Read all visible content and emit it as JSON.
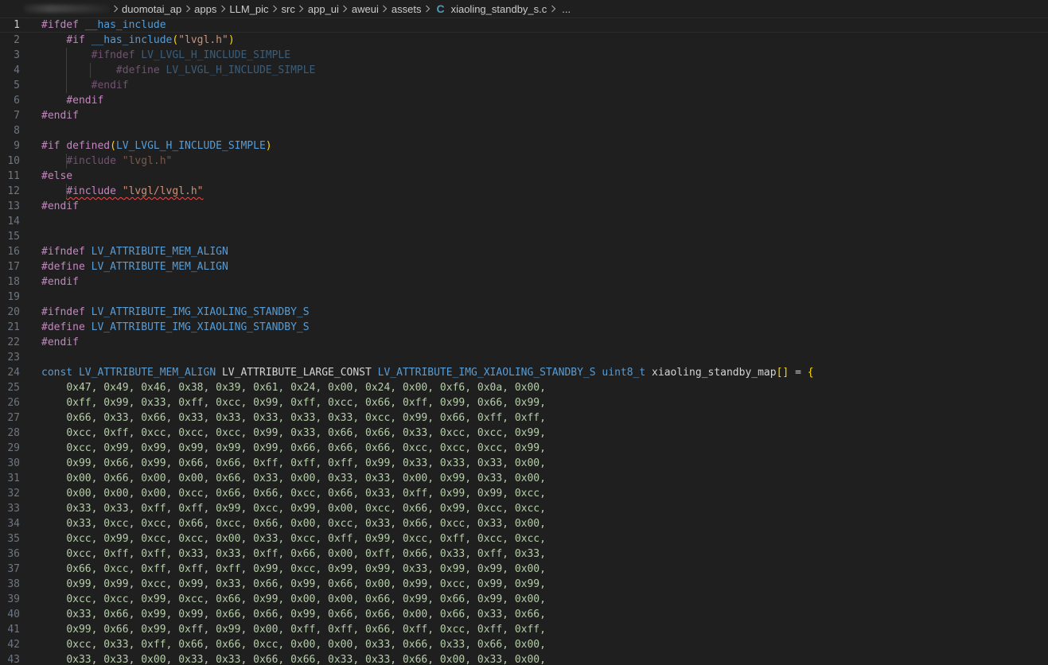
{
  "breadcrumb": {
    "segments": [
      "duomotai_ap",
      "apps",
      "LLM_pic",
      "src",
      "app_ui",
      "aweui",
      "assets"
    ],
    "file_icon": "C",
    "file_name": "xiaoling_standby_s.c",
    "trailing": "..."
  },
  "editor": {
    "current_line": 1,
    "colors": {
      "background": "#1f1f1f",
      "preprocessor": "#c586c0",
      "macro": "#569cd6",
      "string": "#ce9178",
      "number": "#b5cea8",
      "text": "#d4d4d4",
      "bracket": "#ffd700",
      "error_squiggle": "#f14c4c"
    },
    "lines": [
      {
        "n": "1",
        "guides": 0,
        "tokens": [
          {
            "t": "#ifdef ",
            "c": "t-kw"
          },
          {
            "t": "__has_include",
            "c": "t-macro"
          }
        ]
      },
      {
        "n": "2",
        "guides": 0,
        "indent": 1,
        "tokens": [
          {
            "t": "#if ",
            "c": "t-kw"
          },
          {
            "t": "__has_include",
            "c": "t-macro"
          },
          {
            "t": "(",
            "c": "t-br"
          },
          {
            "t": "\"lvgl.h\"",
            "c": "t-str"
          },
          {
            "t": ")",
            "c": "t-br"
          }
        ]
      },
      {
        "n": "3",
        "guides": 1,
        "indent": 2,
        "dim": true,
        "tokens": [
          {
            "t": "#ifndef ",
            "c": "t-kw"
          },
          {
            "t": "LV_LVGL_H_INCLUDE_SIMPLE",
            "c": "t-macro"
          }
        ]
      },
      {
        "n": "4",
        "guides": 2,
        "indent": 3,
        "dim": true,
        "tokens": [
          {
            "t": "#define ",
            "c": "t-kw"
          },
          {
            "t": "LV_LVGL_H_INCLUDE_SIMPLE",
            "c": "t-macro"
          }
        ]
      },
      {
        "n": "5",
        "guides": 1,
        "indent": 2,
        "dim": true,
        "tokens": [
          {
            "t": "#endif",
            "c": "t-kw"
          }
        ]
      },
      {
        "n": "6",
        "guides": 0,
        "indent": 1,
        "tokens": [
          {
            "t": "#endif",
            "c": "t-kw"
          }
        ]
      },
      {
        "n": "7",
        "guides": 0,
        "tokens": [
          {
            "t": "#endif",
            "c": "t-kw"
          }
        ]
      },
      {
        "n": "8",
        "guides": 0,
        "tokens": []
      },
      {
        "n": "9",
        "guides": 0,
        "tokens": [
          {
            "t": "#if ",
            "c": "t-kw"
          },
          {
            "t": "defined",
            "c": "t-kw"
          },
          {
            "t": "(",
            "c": "t-br"
          },
          {
            "t": "LV_LVGL_H_INCLUDE_SIMPLE",
            "c": "t-macro"
          },
          {
            "t": ")",
            "c": "t-br"
          }
        ]
      },
      {
        "n": "10",
        "guides": 0,
        "indent": 1,
        "dim": true,
        "guideAt1": true,
        "tokens": [
          {
            "t": "#include ",
            "c": "t-kw"
          },
          {
            "t": "\"lvgl.h\"",
            "c": "t-str"
          }
        ]
      },
      {
        "n": "11",
        "guides": 0,
        "tokens": [
          {
            "t": "#else",
            "c": "t-kw"
          }
        ]
      },
      {
        "n": "12",
        "guides": 0,
        "indent": 1,
        "guideAt1": true,
        "tokens": [
          {
            "t": "#include ",
            "c": "t-kw squiggle"
          },
          {
            "t": "\"lvgl/lvgl.h\"",
            "c": "t-str squiggle"
          }
        ]
      },
      {
        "n": "13",
        "guides": 0,
        "tokens": [
          {
            "t": "#endif",
            "c": "t-kw"
          }
        ]
      },
      {
        "n": "14",
        "guides": 0,
        "tokens": []
      },
      {
        "n": "15",
        "guides": 0,
        "tokens": []
      },
      {
        "n": "16",
        "guides": 0,
        "tokens": [
          {
            "t": "#ifndef ",
            "c": "t-kw"
          },
          {
            "t": "LV_ATTRIBUTE_MEM_ALIGN",
            "c": "t-macro"
          }
        ]
      },
      {
        "n": "17",
        "guides": 0,
        "tokens": [
          {
            "t": "#define ",
            "c": "t-kw"
          },
          {
            "t": "LV_ATTRIBUTE_MEM_ALIGN",
            "c": "t-macro"
          }
        ]
      },
      {
        "n": "18",
        "guides": 0,
        "tokens": [
          {
            "t": "#endif",
            "c": "t-kw"
          }
        ]
      },
      {
        "n": "19",
        "guides": 0,
        "tokens": []
      },
      {
        "n": "20",
        "guides": 0,
        "tokens": [
          {
            "t": "#ifndef ",
            "c": "t-kw"
          },
          {
            "t": "LV_ATTRIBUTE_IMG_XIAOLING_STANDBY_S",
            "c": "t-macro"
          }
        ]
      },
      {
        "n": "21",
        "guides": 0,
        "tokens": [
          {
            "t": "#define ",
            "c": "t-kw"
          },
          {
            "t": "LV_ATTRIBUTE_IMG_XIAOLING_STANDBY_S",
            "c": "t-macro"
          }
        ]
      },
      {
        "n": "22",
        "guides": 0,
        "tokens": [
          {
            "t": "#endif",
            "c": "t-kw"
          }
        ]
      },
      {
        "n": "23",
        "guides": 0,
        "tokens": []
      },
      {
        "n": "24",
        "guides": 0,
        "tokens": [
          {
            "t": "const ",
            "c": "t-macro"
          },
          {
            "t": "LV_ATTRIBUTE_MEM_ALIGN ",
            "c": "t-macro"
          },
          {
            "t": "LV_ATTRIBUTE_LARGE_CONST ",
            "c": "t-text"
          },
          {
            "t": "LV_ATTRIBUTE_IMG_XIAOLING_STANDBY_S ",
            "c": "t-macro"
          },
          {
            "t": "uint8_t ",
            "c": "t-macro"
          },
          {
            "t": "xiaoling_standby_map",
            "c": "t-text"
          },
          {
            "t": "[]",
            "c": "t-br"
          },
          {
            "t": " = ",
            "c": "t-text"
          },
          {
            "t": "{",
            "c": "t-br"
          }
        ]
      },
      {
        "n": "25",
        "indent": 1,
        "hex": "0x47, 0x49, 0x46, 0x38, 0x39, 0x61, 0x24, 0x00, 0x24, 0x00, 0xf6, 0x0a, 0x00,"
      },
      {
        "n": "26",
        "indent": 1,
        "hex": "0xff, 0x99, 0x33, 0xff, 0xcc, 0x99, 0xff, 0xcc, 0x66, 0xff, 0x99, 0x66, 0x99,"
      },
      {
        "n": "27",
        "indent": 1,
        "hex": "0x66, 0x33, 0x66, 0x33, 0x33, 0x33, 0x33, 0x33, 0xcc, 0x99, 0x66, 0xff, 0xff,"
      },
      {
        "n": "28",
        "indent": 1,
        "hex": "0xcc, 0xff, 0xcc, 0xcc, 0xcc, 0x99, 0x33, 0x66, 0x66, 0x33, 0xcc, 0xcc, 0x99,"
      },
      {
        "n": "29",
        "indent": 1,
        "hex": "0xcc, 0x99, 0x99, 0x99, 0x99, 0x99, 0x66, 0x66, 0x66, 0xcc, 0xcc, 0xcc, 0x99,"
      },
      {
        "n": "30",
        "indent": 1,
        "hex": "0x99, 0x66, 0x99, 0x66, 0x66, 0xff, 0xff, 0xff, 0x99, 0x33, 0x33, 0x33, 0x00,"
      },
      {
        "n": "31",
        "indent": 1,
        "hex": "0x00, 0x66, 0x00, 0x00, 0x66, 0x33, 0x00, 0x33, 0x33, 0x00, 0x99, 0x33, 0x00,"
      },
      {
        "n": "32",
        "indent": 1,
        "hex": "0x00, 0x00, 0x00, 0xcc, 0x66, 0x66, 0xcc, 0x66, 0x33, 0xff, 0x99, 0x99, 0xcc,"
      },
      {
        "n": "33",
        "indent": 1,
        "hex": "0x33, 0x33, 0xff, 0xff, 0x99, 0xcc, 0x99, 0x00, 0xcc, 0x66, 0x99, 0xcc, 0xcc,"
      },
      {
        "n": "34",
        "indent": 1,
        "hex": "0x33, 0xcc, 0xcc, 0x66, 0xcc, 0x66, 0x00, 0xcc, 0x33, 0x66, 0xcc, 0x33, 0x00,"
      },
      {
        "n": "35",
        "indent": 1,
        "hex": "0xcc, 0x99, 0xcc, 0xcc, 0x00, 0x33, 0xcc, 0xff, 0x99, 0xcc, 0xff, 0xcc, 0xcc,"
      },
      {
        "n": "36",
        "indent": 1,
        "hex": "0xcc, 0xff, 0xff, 0x33, 0x33, 0xff, 0x66, 0x00, 0xff, 0x66, 0x33, 0xff, 0x33,"
      },
      {
        "n": "37",
        "indent": 1,
        "hex": "0x66, 0xcc, 0xff, 0xff, 0xff, 0x99, 0xcc, 0x99, 0x99, 0x33, 0x99, 0x99, 0x00,"
      },
      {
        "n": "38",
        "indent": 1,
        "hex": "0x99, 0x99, 0xcc, 0x99, 0x33, 0x66, 0x99, 0x66, 0x00, 0x99, 0xcc, 0x99, 0x99,"
      },
      {
        "n": "39",
        "indent": 1,
        "hex": "0xcc, 0xcc, 0x99, 0xcc, 0x66, 0x99, 0x00, 0x00, 0x66, 0x99, 0x66, 0x99, 0x00,"
      },
      {
        "n": "40",
        "indent": 1,
        "hex": "0x33, 0x66, 0x99, 0x99, 0x66, 0x66, 0x99, 0x66, 0x66, 0x00, 0x66, 0x33, 0x66,"
      },
      {
        "n": "41",
        "indent": 1,
        "hex": "0x99, 0x66, 0x99, 0xff, 0x99, 0x00, 0xff, 0xff, 0x66, 0xff, 0xcc, 0xff, 0xff,"
      },
      {
        "n": "42",
        "indent": 1,
        "hex": "0xcc, 0x33, 0xff, 0x66, 0x66, 0xcc, 0x00, 0x00, 0x33, 0x66, 0x33, 0x66, 0x00,"
      },
      {
        "n": "43",
        "indent": 1,
        "hex": "0x33, 0x33, 0x00, 0x33, 0x33, 0x66, 0x66, 0x33, 0x33, 0x66, 0x00, 0x33, 0x00,"
      }
    ]
  }
}
